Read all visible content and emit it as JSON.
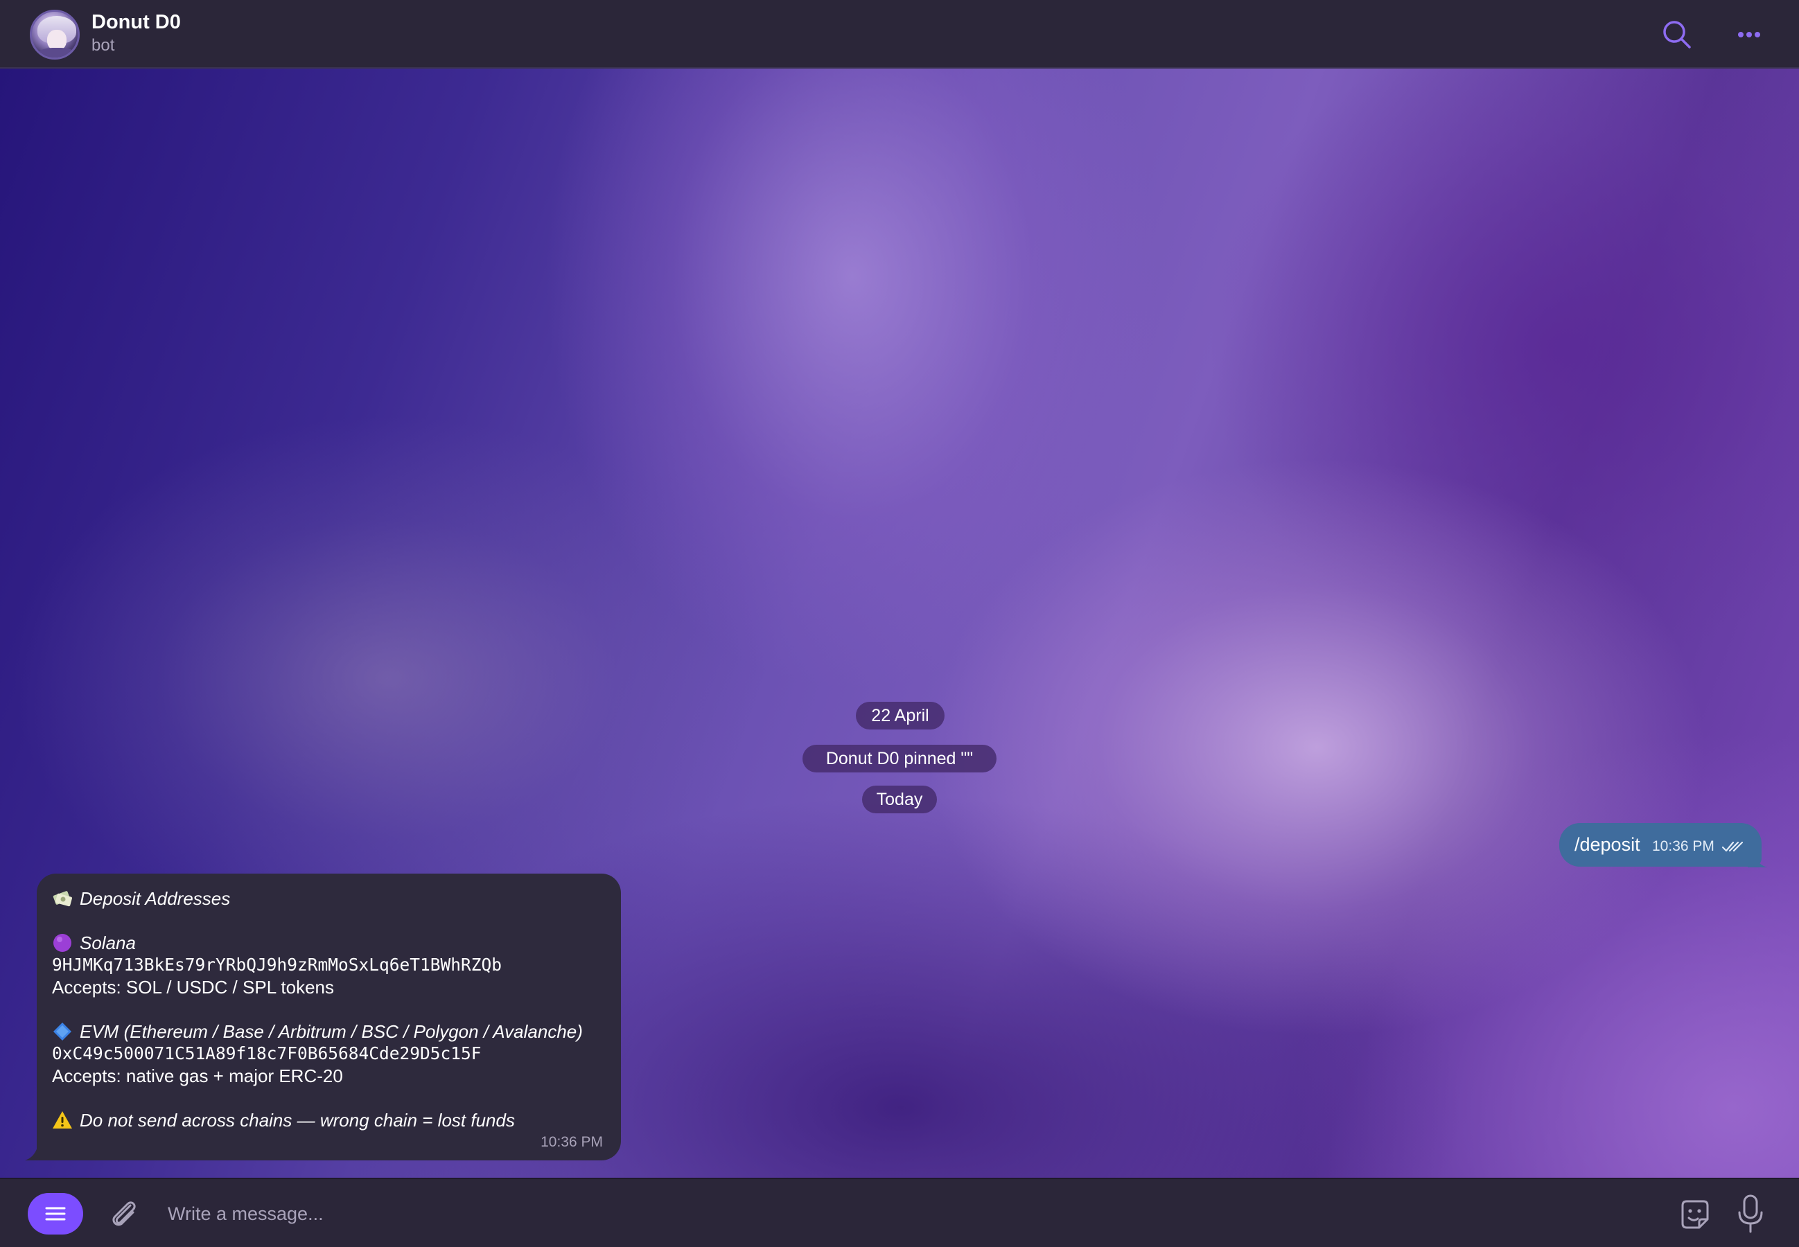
{
  "header": {
    "title": "Donut D0",
    "status": "bot",
    "icons": [
      "search-icon",
      "more-icon"
    ]
  },
  "service": {
    "date_pill": "22 April",
    "pinned_pill": "Donut D0 pinned \"\"",
    "today_pill": "Today"
  },
  "outgoing": {
    "text": "/deposit",
    "time": "10:36 PM",
    "read_status": "double-check"
  },
  "incoming": {
    "heading": "Deposit Addresses",
    "solana_label": "Solana",
    "solana_address": "9HJMKq713BkEs79rYRbQJ9h9zRmMoSxLq6eT1BWhRZQb",
    "solana_accepts": "Accepts: SOL / USDC / SPL tokens",
    "evm_label": "EVM (Ethereum / Base / Arbitrum / BSC / Polygon / Avalanche)",
    "evm_address": "0xC49c500071C51A89f18c7F0B65684Cde29D5c15F",
    "evm_accepts": "Accepts: native gas + major ERC-20",
    "warning": "Do not send across chains — wrong chain = lost funds",
    "time": "10:36 PM",
    "icons": [
      "money-emoji-icon",
      "purple-circle-icon",
      "blue-diamond-icon",
      "warning-icon"
    ]
  },
  "composer": {
    "placeholder": "Write a message...",
    "icons": [
      "menu-icon",
      "paperclip-icon",
      "sticker-icon",
      "microphone-icon"
    ]
  },
  "colors": {
    "header_bg": "#2b2639",
    "accent": "#7c4dff",
    "outgoing_bubble": "#3f6c9d",
    "incoming_bubble": "#2e2a3d"
  }
}
